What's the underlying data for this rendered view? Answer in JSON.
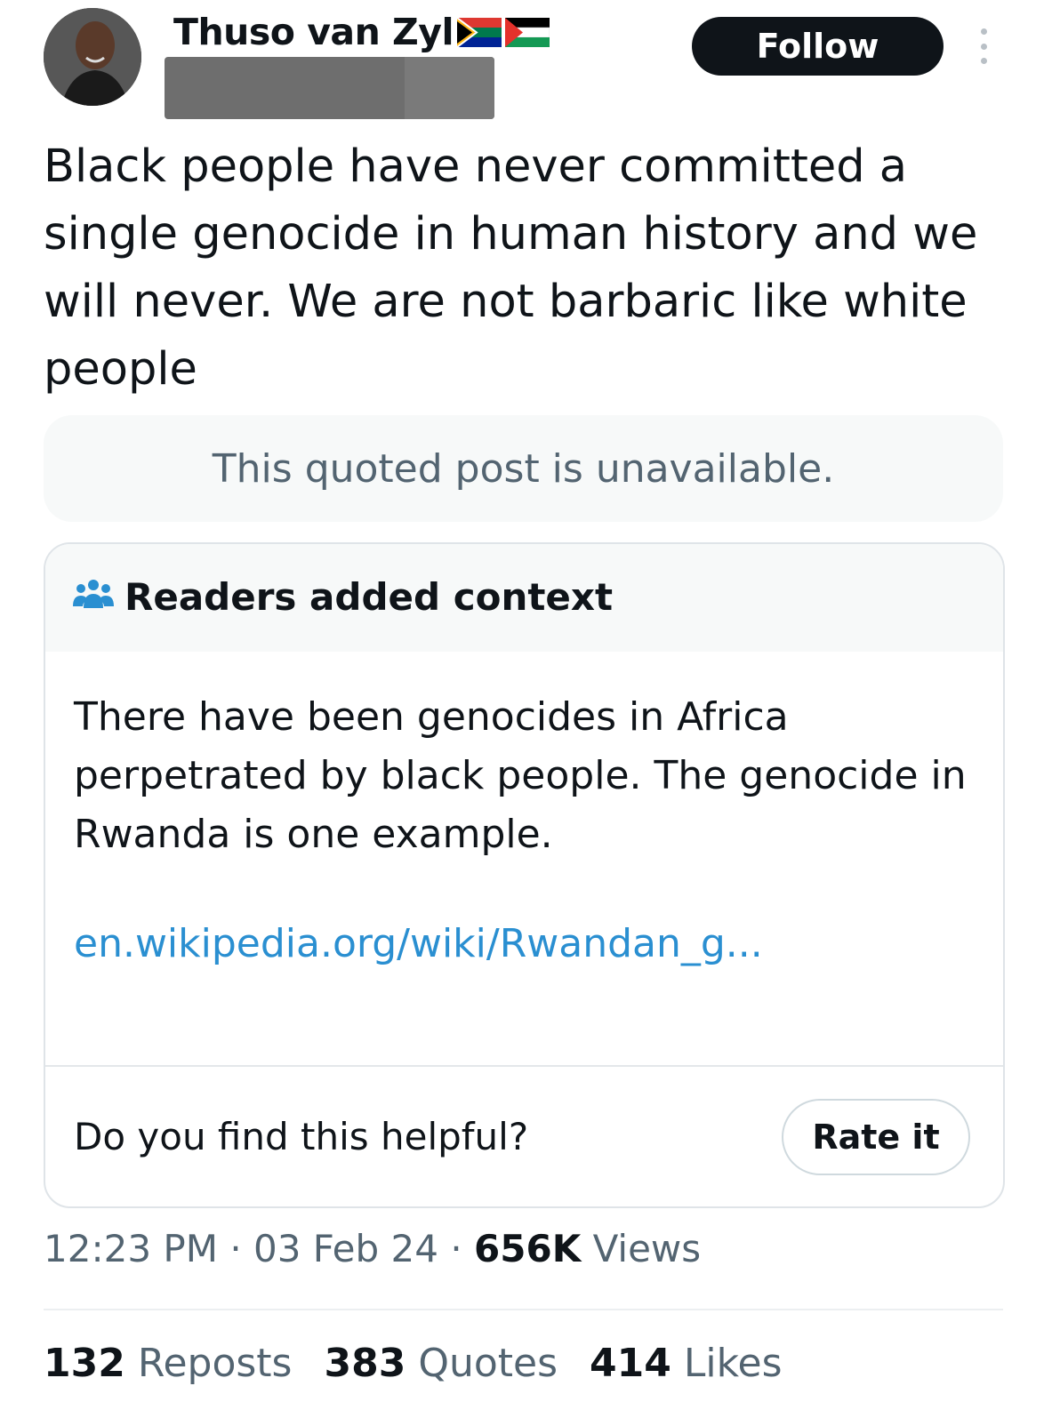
{
  "header": {
    "display_name": "Thuso van Zyl",
    "follow_label": "Follow"
  },
  "post": {
    "text": "Black people have never committed a single genocide in human history and we will never. We are not barbaric like white people",
    "quoted_unavailable": "This quoted post is unavailable."
  },
  "note": {
    "title": "Readers added context",
    "body": "There have been genocides in Africa perpetrated by black people. The genocide in Rwanda is one example.",
    "link": "en.wikipedia.org/wiki/Rwandan_g...",
    "helpful_question": "Do you find this helpful?",
    "rate_label": "Rate it"
  },
  "meta": {
    "time": "12:23 PM",
    "date": "03 Feb 24",
    "views_count": "656K",
    "views_label": "Views"
  },
  "stats": {
    "reposts_count": "132",
    "reposts_label": "Reposts",
    "quotes_count": "383",
    "quotes_label": "Quotes",
    "likes_count": "414",
    "likes_label": "Likes"
  },
  "icons": {
    "flags": [
      "south-africa-flag-icon",
      "palestine-flag-icon"
    ],
    "note_icon": "readers-icon",
    "more": "more-vertical-icon"
  },
  "colors": {
    "link": "#2a8fd1",
    "secondary_text": "#536471",
    "follow_bg": "#0f1419"
  }
}
